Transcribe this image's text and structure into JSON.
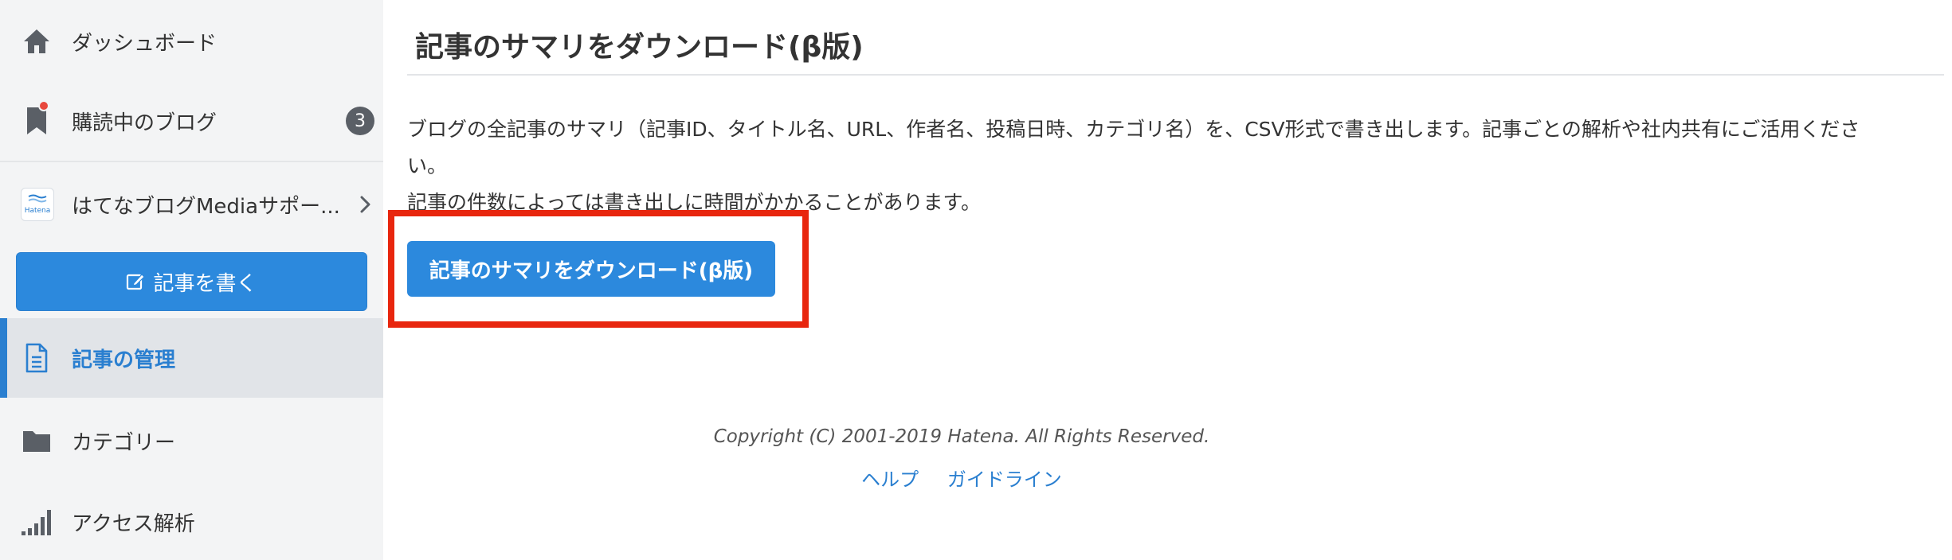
{
  "sidebar": {
    "items": [
      {
        "id": "dashboard",
        "label": "ダッシュボード",
        "icon": "home-icon"
      },
      {
        "id": "subscribed-blogs",
        "label": "購読中のブログ",
        "icon": "bookmark-icon",
        "badge": "3"
      },
      {
        "id": "blog",
        "label": "はてなブログMediaサポー...",
        "icon": "hatena-logo-icon",
        "logo_text": "Hatena"
      },
      {
        "id": "manage-articles",
        "label": "記事の管理",
        "icon": "document-icon",
        "active": true
      },
      {
        "id": "categories",
        "label": "カテゴリー",
        "icon": "folder-icon"
      },
      {
        "id": "analytics",
        "label": "アクセス解析",
        "icon": "signal-bars-icon"
      }
    ],
    "write_button": {
      "label": "記事を書く",
      "icon": "edit-icon"
    }
  },
  "main": {
    "title": "記事のサマリをダウンロード(β版)",
    "description_lines": [
      "ブログの全記事のサマリ（記事ID、タイトル名、URL、作者名、投稿日時、カテゴリ名）を、CSV形式で書き出します。記事ごとの解析や社内共有にご活用くださ",
      "い。",
      "記事の件数によっては書き出しに時間がかかることがあります。"
    ],
    "download_button": {
      "label": "記事のサマリをダウンロード(β版)"
    }
  },
  "footer": {
    "copyright": "Copyright (C) 2001-2019 Hatena. All Rights Reserved.",
    "links": [
      {
        "label": "ヘルプ"
      },
      {
        "label": "ガイドライン"
      }
    ]
  },
  "colors": {
    "accent": "#2c89dd",
    "sidebar_bg": "#f3f4f5",
    "active_bg": "#e1e4e8",
    "highlight": "#e8260e",
    "notification": "#e8483d"
  }
}
